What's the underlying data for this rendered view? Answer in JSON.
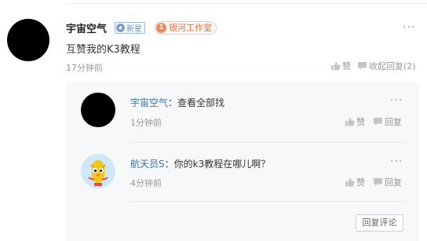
{
  "comment": {
    "author": "宇宙空气",
    "badge_new": "新星",
    "badge_studio": "银河工作室",
    "badge_studio_number": "1",
    "text": "互赞我的K3教程",
    "time": "17分钟前",
    "like_label": "赞",
    "collapse_label": "收起回复(2)",
    "more_icon": "more-dots-icon"
  },
  "replies": [
    {
      "author": "宇宙空气",
      "separator": "：",
      "text": "查看全部找",
      "time": "1分钟前",
      "like_label": "赞",
      "reply_label": "回复"
    },
    {
      "author": "航天员S",
      "separator": "：",
      "text": "你的k3教程在哪儿啊？",
      "time": "4分钟前",
      "like_label": "赞",
      "reply_label": "回复"
    }
  ],
  "reply_comment_button": "回复评论",
  "colors": {
    "author_link": "#3b6fb6",
    "badge_orange": "#f08a5d",
    "badge_blue": "#7a9cc8",
    "panel_bg": "#f7f8fa"
  }
}
